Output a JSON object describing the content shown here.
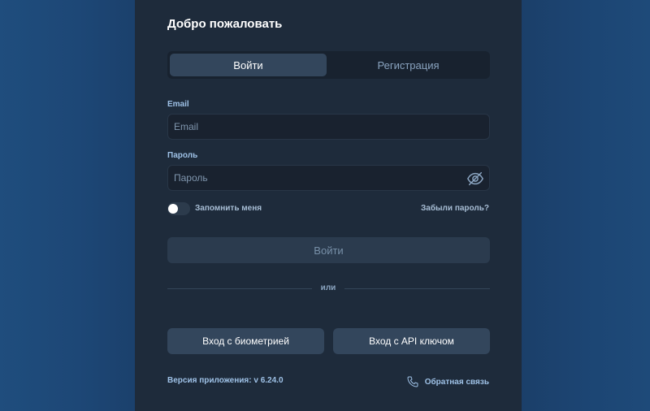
{
  "title": "Добро пожаловать",
  "tabs": [
    {
      "label": "Войти",
      "active": true
    },
    {
      "label": "Регистрация",
      "active": false
    }
  ],
  "form": {
    "email_label": "Email",
    "email_placeholder": "Email",
    "email_value": "",
    "password_label": "Пароль",
    "password_placeholder": "Пароль",
    "password_value": "",
    "remember_label": "Запомнить меня",
    "remember_checked": false,
    "forgot_label": "Забыли пароль?",
    "submit_label": "Войти"
  },
  "divider_text": "или",
  "alt_login": {
    "biometric_label": "Вход с биометрией",
    "api_key_label": "Вход с API ключом"
  },
  "footer": {
    "version_text": "Версия приложения: v 6.24.0",
    "feedback_label": "Обратная связь"
  },
  "icons": {
    "password_toggle": "eye-off-icon",
    "feedback": "phone-icon"
  },
  "colors": {
    "background": "#1b416d",
    "panel": "#1e2b3b",
    "accent_text": "#9ec1e6"
  }
}
